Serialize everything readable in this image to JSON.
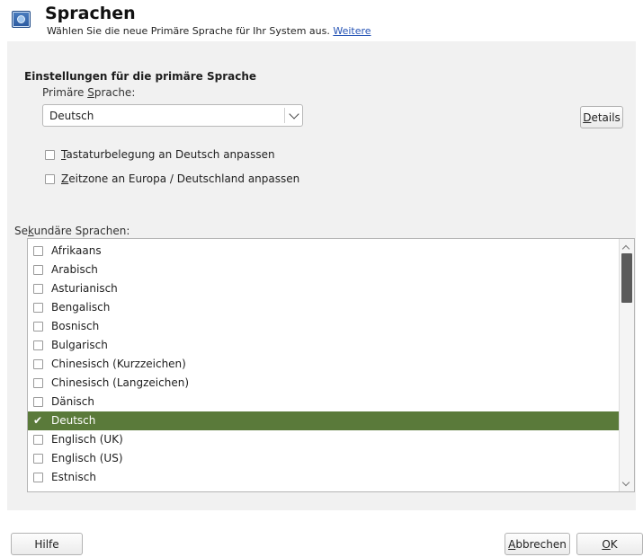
{
  "header": {
    "title": "Sprachen",
    "subtitle": "Wählen Sie die neue Primäre Sprache für Ihr System aus.",
    "link": "Weitere"
  },
  "primary": {
    "group_title": "Einstellungen für die primäre Sprache",
    "label_pre": "Primäre ",
    "label_accel": "S",
    "label_post": "prache:",
    "selected_value": "Deutsch",
    "details_accel": "D",
    "details_rest": "etails"
  },
  "options": [
    {
      "accel": "T",
      "rest": "astaturbelegung an Deutsch anpassen",
      "checked": false
    },
    {
      "accel": "Z",
      "rest": "eitzone an Europa / Deutschland anpassen",
      "checked": false
    }
  ],
  "secondary": {
    "label_pre": "Se",
    "label_accel": "k",
    "label_post": "undäre Sprachen:",
    "items": [
      {
        "label": "Afrikaans",
        "checked": false
      },
      {
        "label": "Arabisch",
        "checked": false
      },
      {
        "label": "Asturianisch",
        "checked": false
      },
      {
        "label": "Bengalisch",
        "checked": false
      },
      {
        "label": "Bosnisch",
        "checked": false
      },
      {
        "label": "Bulgarisch",
        "checked": false
      },
      {
        "label": "Chinesisch (Kurzzeichen)",
        "checked": false
      },
      {
        "label": "Chinesisch (Langzeichen)",
        "checked": false
      },
      {
        "label": "Dänisch",
        "checked": false
      },
      {
        "label": "Deutsch",
        "checked": true
      },
      {
        "label": "Englisch (UK)",
        "checked": false
      },
      {
        "label": "Englisch (US)",
        "checked": false
      },
      {
        "label": "Estnisch",
        "checked": false
      }
    ]
  },
  "buttons": {
    "help": "Hilfe",
    "cancel_accel": "A",
    "cancel_rest": "bbrechen",
    "ok_accel": "O",
    "ok_rest": "K"
  },
  "colors": {
    "selection": "#5a7a3a",
    "link": "#2553b5"
  },
  "icons": {
    "header": "language-globe-icon",
    "dropdown": "chevron-down-icon",
    "check": "checkmark-icon"
  }
}
